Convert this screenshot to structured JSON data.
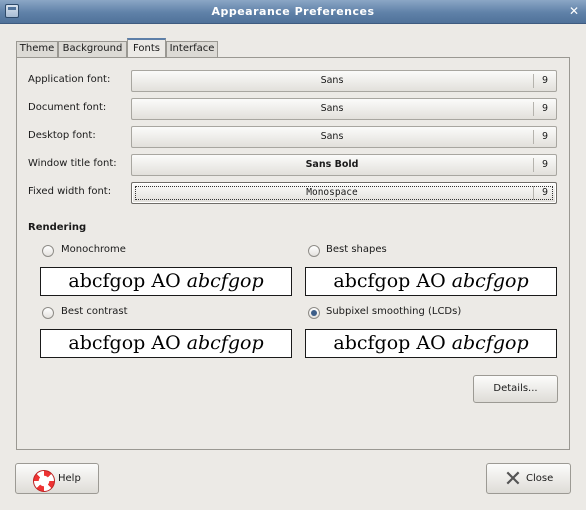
{
  "window": {
    "title": "Appearance Preferences"
  },
  "tabs": [
    {
      "label": "Theme"
    },
    {
      "label": "Background"
    },
    {
      "label": "Fonts",
      "active": true
    },
    {
      "label": "Interface"
    }
  ],
  "fonts": [
    {
      "label": "Application font:",
      "name": "Sans",
      "size": "9"
    },
    {
      "label": "Document font:",
      "name": "Sans",
      "size": "9"
    },
    {
      "label": "Desktop font:",
      "name": "Sans",
      "size": "9"
    },
    {
      "label": "Window title font:",
      "name": "Sans Bold",
      "size": "9"
    },
    {
      "label": "Fixed width font:",
      "name": "Monospace",
      "size": "9"
    }
  ],
  "rendering": {
    "title": "Rendering",
    "options": [
      {
        "label": "Monochrome",
        "checked": false
      },
      {
        "label": "Best shapes",
        "checked": false
      },
      {
        "label": "Best contrast",
        "checked": false
      },
      {
        "label": "Subpixel smoothing (LCDs)",
        "checked": true
      }
    ],
    "sample_regular": "abcfgop AO",
    "sample_italic": "abcfgop"
  },
  "buttons": {
    "details": "Details...",
    "help": "Help",
    "close": "Close"
  },
  "colors": {
    "titlebar": "#5f81a8",
    "accent": "#3c5d88"
  }
}
